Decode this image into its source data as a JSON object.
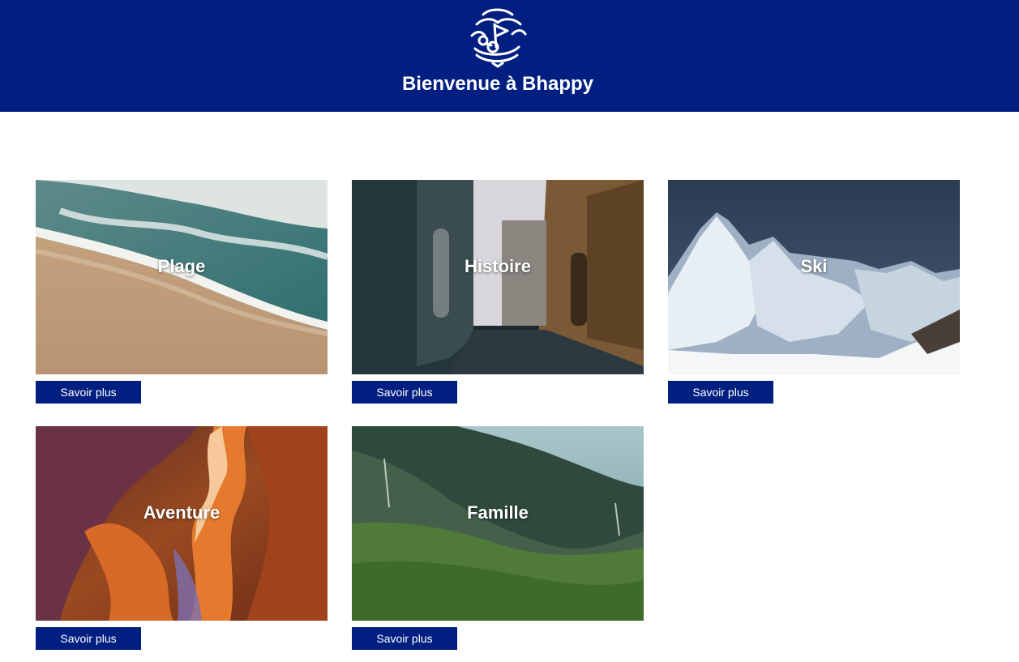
{
  "header": {
    "title": "Bienvenue à Bhappy",
    "logo_icon": "bhappy-logo-icon",
    "background_color": "#011f80"
  },
  "cards": [
    {
      "label": "Plage",
      "button_label": "Savoir plus",
      "image": "beach-waves-image"
    },
    {
      "label": "Histoire",
      "button_label": "Savoir plus",
      "image": "old-town-street-image"
    },
    {
      "label": "Ski",
      "button_label": "Savoir plus",
      "image": "snowy-mountains-image"
    },
    {
      "label": "Aventure",
      "button_label": "Savoir plus",
      "image": "canyon-image"
    },
    {
      "label": "Famille",
      "button_label": "Savoir plus",
      "image": "green-valley-image"
    }
  ],
  "colors": {
    "primary": "#011f80",
    "button_text": "#ffffff"
  }
}
